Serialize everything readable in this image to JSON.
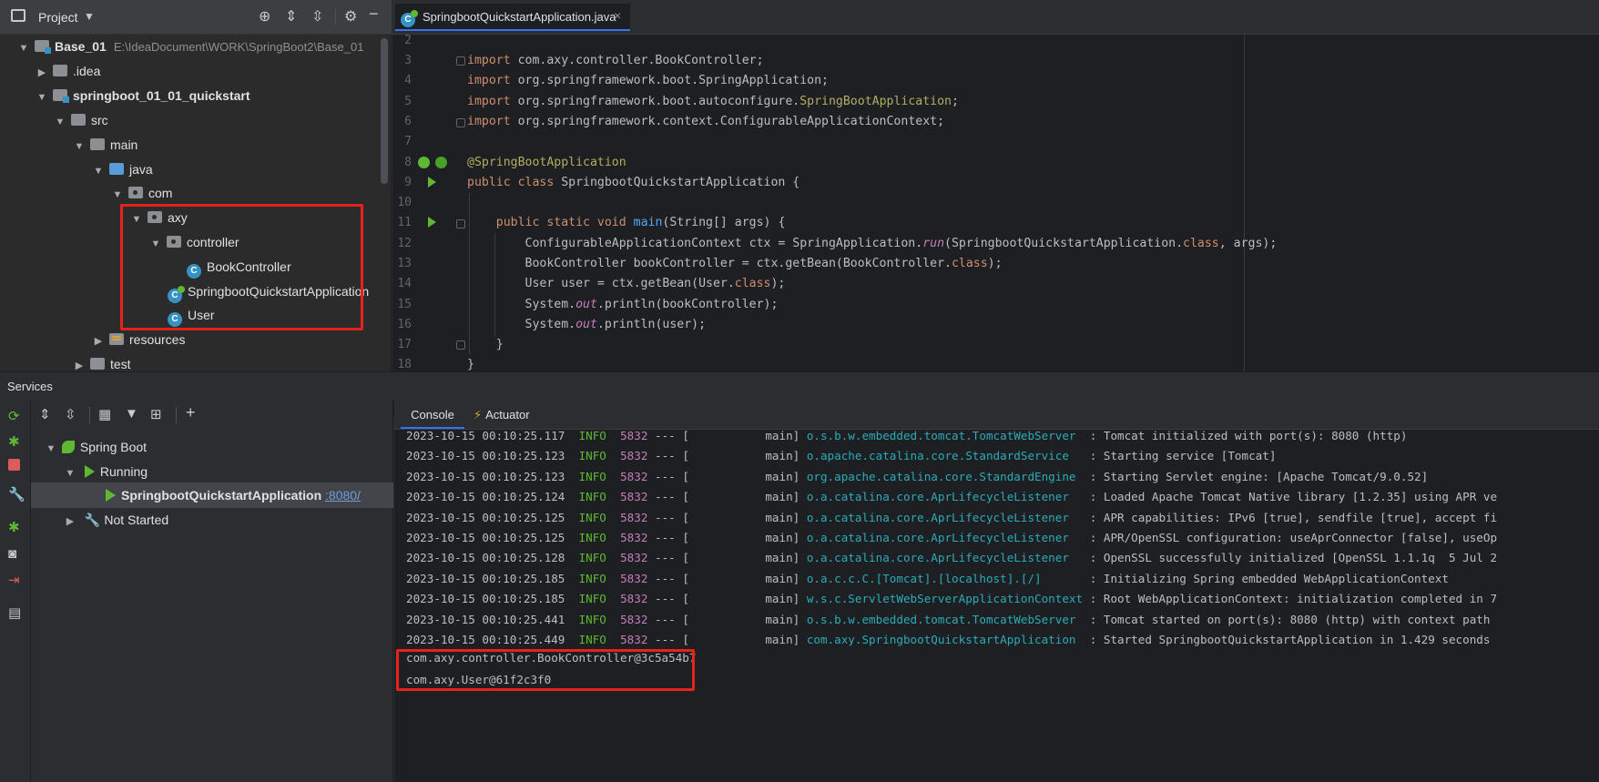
{
  "project": {
    "title": "Project",
    "tree": [
      {
        "label": "Base_01",
        "path": "E:\\IdeaDocument\\WORK\\SpringBoot2\\Base_01"
      },
      {
        "label": ".idea"
      },
      {
        "label": "springboot_01_01_quickstart"
      },
      {
        "label": "src"
      },
      {
        "label": "main"
      },
      {
        "label": "java"
      },
      {
        "label": "com"
      },
      {
        "label": "axy"
      },
      {
        "label": "controller"
      },
      {
        "label": "BookController"
      },
      {
        "label": "SpringbootQuickstartApplication"
      },
      {
        "label": "User"
      },
      {
        "label": "resources"
      },
      {
        "label": "test"
      }
    ]
  },
  "editor": {
    "tab_label": "SpringbootQuickstartApplication.java",
    "tab_close": "×",
    "line_numbers": [
      "2",
      "3",
      "4",
      "5",
      "6",
      "7",
      "8",
      "9",
      "10",
      "11",
      "12",
      "13",
      "14",
      "15",
      "16",
      "17",
      "18"
    ]
  },
  "services": {
    "title": "Services",
    "spring_boot": "Spring Boot",
    "running": "Running",
    "app": "SpringbootQuickstartApplication",
    "port": ":8080/",
    "not_started": "Not Started"
  },
  "console": {
    "tab_console": "Console",
    "tab_actuator": "Actuator",
    "logs": [
      {
        "ts": "2023-10-15 00:10:25.117",
        "lvl": "INFO",
        "pid": "5832",
        "sep": " --- [           main] ",
        "logger": "o.s.b.w.embedded.tomcat.TomcatWebServer ",
        "msg": " : Tomcat initialized with port(s): 8080 (http)"
      },
      {
        "ts": "2023-10-15 00:10:25.123",
        "lvl": "INFO",
        "pid": "5832",
        "sep": " --- [           main] ",
        "logger": "o.apache.catalina.core.StandardService  ",
        "msg": " : Starting service [Tomcat]"
      },
      {
        "ts": "2023-10-15 00:10:25.123",
        "lvl": "INFO",
        "pid": "5832",
        "sep": " --- [           main] ",
        "logger": "org.apache.catalina.core.StandardEngine ",
        "msg": " : Starting Servlet engine: [Apache Tomcat/9.0.52]"
      },
      {
        "ts": "2023-10-15 00:10:25.124",
        "lvl": "INFO",
        "pid": "5832",
        "sep": " --- [           main] ",
        "logger": "o.a.catalina.core.AprLifecycleListener  ",
        "msg": " : Loaded Apache Tomcat Native library [1.2.35] using APR ve"
      },
      {
        "ts": "2023-10-15 00:10:25.125",
        "lvl": "INFO",
        "pid": "5832",
        "sep": " --- [           main] ",
        "logger": "o.a.catalina.core.AprLifecycleListener  ",
        "msg": " : APR capabilities: IPv6 [true], sendfile [true], accept fi"
      },
      {
        "ts": "2023-10-15 00:10:25.125",
        "lvl": "INFO",
        "pid": "5832",
        "sep": " --- [           main] ",
        "logger": "o.a.catalina.core.AprLifecycleListener  ",
        "msg": " : APR/OpenSSL configuration: useAprConnector [false], useOp"
      },
      {
        "ts": "2023-10-15 00:10:25.128",
        "lvl": "INFO",
        "pid": "5832",
        "sep": " --- [           main] ",
        "logger": "o.a.catalina.core.AprLifecycleListener  ",
        "msg": " : OpenSSL successfully initialized [OpenSSL 1.1.1q  5 Jul 2"
      },
      {
        "ts": "2023-10-15 00:10:25.185",
        "lvl": "INFO",
        "pid": "5832",
        "sep": " --- [           main] ",
        "logger": "o.a.c.c.C.[Tomcat].[localhost].[/]      ",
        "msg": " : Initializing Spring embedded WebApplicationContext"
      },
      {
        "ts": "2023-10-15 00:10:25.185",
        "lvl": "INFO",
        "pid": "5832",
        "sep": " --- [           main] ",
        "logger": "w.s.c.ServletWebServerApplicationContext",
        "msg": " : Root WebApplicationContext: initialization completed in 7"
      },
      {
        "ts": "2023-10-15 00:10:25.441",
        "lvl": "INFO",
        "pid": "5832",
        "sep": " --- [           main] ",
        "logger": "o.s.b.w.embedded.tomcat.TomcatWebServer ",
        "msg": " : Tomcat started on port(s): 8080 (http) with context path"
      },
      {
        "ts": "2023-10-15 00:10:25.449",
        "lvl": "INFO",
        "pid": "5832",
        "sep": " --- [           main] ",
        "logger": "com.axy.SpringbootQuickstartApplication ",
        "msg": " : Started SpringbootQuickstartApplication in 1.429 seconds"
      }
    ],
    "output": [
      "com.axy.controller.BookController@3c5a54b7",
      "com.axy.User@61f2c3f0"
    ]
  },
  "colors": {
    "accent": "#3574f0",
    "highlight_box": "#e5231d",
    "run_green": "#5fb832"
  }
}
